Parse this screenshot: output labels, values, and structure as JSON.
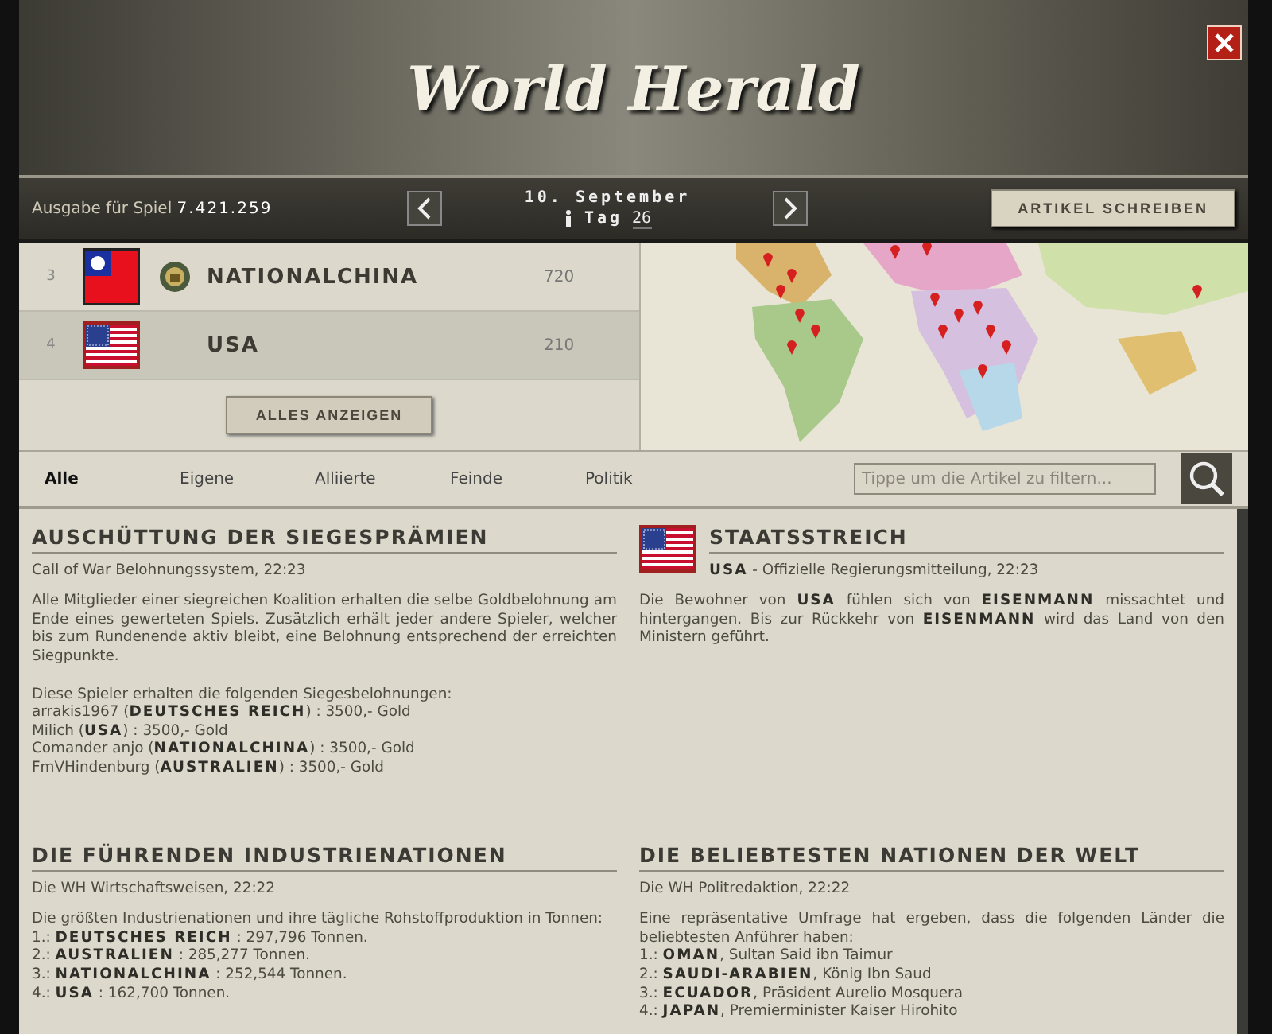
{
  "header": {
    "title": "World Herald",
    "edition_label": "Ausgabe für Spiel",
    "game_id": "7.421.259",
    "date": "10. September",
    "day_label": "Tag",
    "day": "26",
    "write_button": "ARTIKEL SCHREIBEN"
  },
  "ranking": {
    "rows": [
      {
        "rank": "3",
        "flag": {
          "kind": "roc"
        },
        "badge": true,
        "nation": "NATIONALCHINA",
        "points": "720",
        "selected": false
      },
      {
        "rank": "4",
        "flag": {
          "kind": "usa"
        },
        "badge": false,
        "nation": "USA",
        "points": "210",
        "selected": true
      }
    ],
    "show_all": "ALLES ANZEIGEN"
  },
  "filters": {
    "tabs": [
      {
        "label": "Alle",
        "selected": true
      },
      {
        "label": "Eigene",
        "selected": false
      },
      {
        "label": "Alliierte",
        "selected": false
      },
      {
        "label": "Feinde",
        "selected": false
      },
      {
        "label": "Politik",
        "selected": false
      }
    ],
    "search": {
      "placeholder": "Tippe um die Artikel zu filtern..."
    }
  },
  "articles": [
    {
      "title": "AUSCHÜTTUNG DER SIEGESPRÄMIEN",
      "meta": "Call of War Belohnungssystem, 22:23",
      "blocks": [
        {
          "kind": "paragraph",
          "text": "Alle Mitglieder einer siegreichen Koalition erhalten die selbe Goldbelohnung am Ende eines gewerteten Spiels. Zusätzlich erhält jeder andere Spieler, welcher bis zum Rundenende aktiv bleibt, eine Belohnung entsprechend der erreichten Siegpunkte."
        },
        {
          "kind": "lines",
          "spaced": true,
          "items": [
            "Diese Spieler erhalten die folgenden Siegesbelohnungen:",
            "arrakis1967 (**DEUTSCHES REICH**) : 3500,- Gold",
            "Milich (**USA**) : 3500,- Gold",
            "Comander anjo (**NATIONALCHINA**) : 3500,- Gold",
            "FmVHindenburg (**AUSTRALIEN**) : 3500,- Gold"
          ]
        }
      ]
    },
    {
      "flag": {
        "kind": "usa"
      },
      "title": "STAATSSTREICH",
      "meta": "**USA** - Offizielle Regierungsmitteilung, 22:23",
      "blocks": [
        {
          "kind": "paragraph",
          "text": "Die Bewohner von **USA** fühlen sich von **EISENMANN** missachtet und hintergangen. Bis zur Rückkehr von **EISENMANN** wird das Land von den Ministern geführt."
        }
      ]
    },
    {
      "title": "DIE FÜHRENDEN INDUSTRIENATIONEN",
      "meta": "Die WH Wirtschaftsweisen, 22:22",
      "blocks": [
        {
          "kind": "paragraph",
          "text": "Die größten Industrienationen und ihre tägliche Rohstoffproduktion in Tonnen:"
        },
        {
          "kind": "lines",
          "spaced": false,
          "items": [
            "1.: **DEUTSCHES REICH** : 297,796 Tonnen.",
            "2.: **AUSTRALIEN** : 285,277 Tonnen.",
            "3.: **NATIONALCHINA** : 252,544 Tonnen.",
            "4.: **USA** : 162,700 Tonnen."
          ]
        }
      ]
    },
    {
      "title": "DIE BELIEBTESTEN NATIONEN DER WELT",
      "meta": "Die WH Politredaktion, 22:22",
      "blocks": [
        {
          "kind": "paragraph",
          "text": "Eine repräsentative Umfrage hat ergeben, dass die folgenden Länder die beliebtesten Anführer haben:"
        },
        {
          "kind": "lines",
          "spaced": false,
          "items": [
            "1.: **OMAN**, Sultan Said ibn Taimur",
            "2.: **SAUDI-ARABIEN**, König Ibn Saud",
            "3.: **ECUADOR**, Präsident Aurelio Mosquera",
            "4.: **JAPAN**, Premierminister Kaiser Hirohito"
          ]
        }
      ]
    }
  ]
}
